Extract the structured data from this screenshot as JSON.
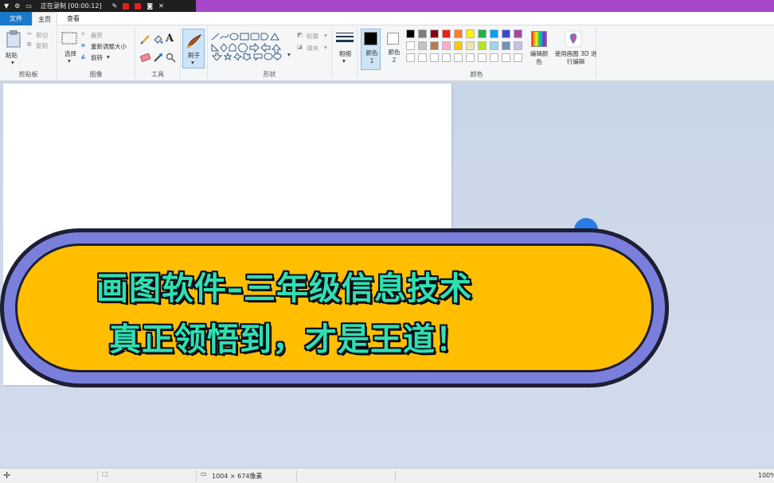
{
  "recorder": {
    "status": "正在录制 [00:00:12]"
  },
  "tabs": {
    "file": "文件",
    "home": "主页",
    "view": "查看"
  },
  "clipboard": {
    "paste": "粘贴",
    "cut": "剪切",
    "copy": "复制",
    "group": "剪贴板"
  },
  "image": {
    "select": "选择",
    "crop": "裁剪",
    "resize": "重新调整大小",
    "rotate": "旋转",
    "group": "图像"
  },
  "tools": {
    "group": "工具",
    "text_glyph": "A"
  },
  "brushes": {
    "label": "刷子"
  },
  "shapes": {
    "outline": "轮廓",
    "fill": "填充",
    "group": "形状"
  },
  "size": {
    "label": "粗细"
  },
  "colors": {
    "color1": "颜色 1",
    "color2": "颜色 2",
    "edit": "编辑颜色",
    "group": "颜色",
    "palette_row1": [
      "#000000",
      "#7f7f7f",
      "#880015",
      "#ed1c24",
      "#ff7f27",
      "#fff200",
      "#22b14c",
      "#00a2e8",
      "#3f48cc",
      "#a349a4"
    ],
    "palette_row2": [
      "#ffffff",
      "#c3c3c3",
      "#b97a57",
      "#ffaec9",
      "#ffc90e",
      "#efe4b0",
      "#b5e61d",
      "#99d9ea",
      "#7092be",
      "#c8bfe7"
    ]
  },
  "paint3d": {
    "label": "使用画图 3D 进行编辑"
  },
  "banner": {
    "line1": "画图软件–三年级信息技术",
    "line2": "真正领悟到，才是王道！"
  },
  "status": {
    "dimensions": "1004 × 674像素",
    "zoom": "100%"
  }
}
